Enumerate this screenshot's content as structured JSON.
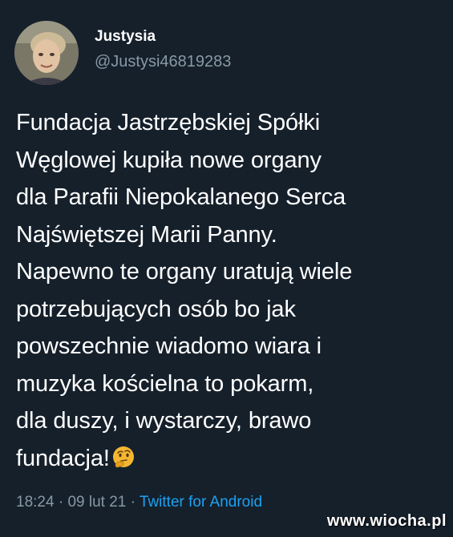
{
  "author": {
    "display_name": "Justysia",
    "handle": "@Justysi46819283"
  },
  "tweet": {
    "text": "Fundacja Jastrzębskiej Spółki\nWęglowej kupiła nowe organy\ndla Parafii Niepokalanego Serca\nNajświętszej Marii Panny.\nNapewno te organy uratują wiele\npotrzebujących osób bo jak\npowszechnie wiadomo wiara i\nmuzyka kościelna to pokarm,\ndla duszy, i wystarczy, brawo\nfundacja!",
    "emoji": "thinking-face-icon"
  },
  "meta": {
    "time": "18:24",
    "separator1": " · ",
    "date": "09 lut 21",
    "separator2": " · ",
    "source": "Twitter for Android"
  },
  "watermark": "www.wiocha.pl",
  "colors": {
    "background": "#15202b",
    "text": "#ffffff",
    "secondary": "#8899a6",
    "link": "#1da1f2"
  }
}
